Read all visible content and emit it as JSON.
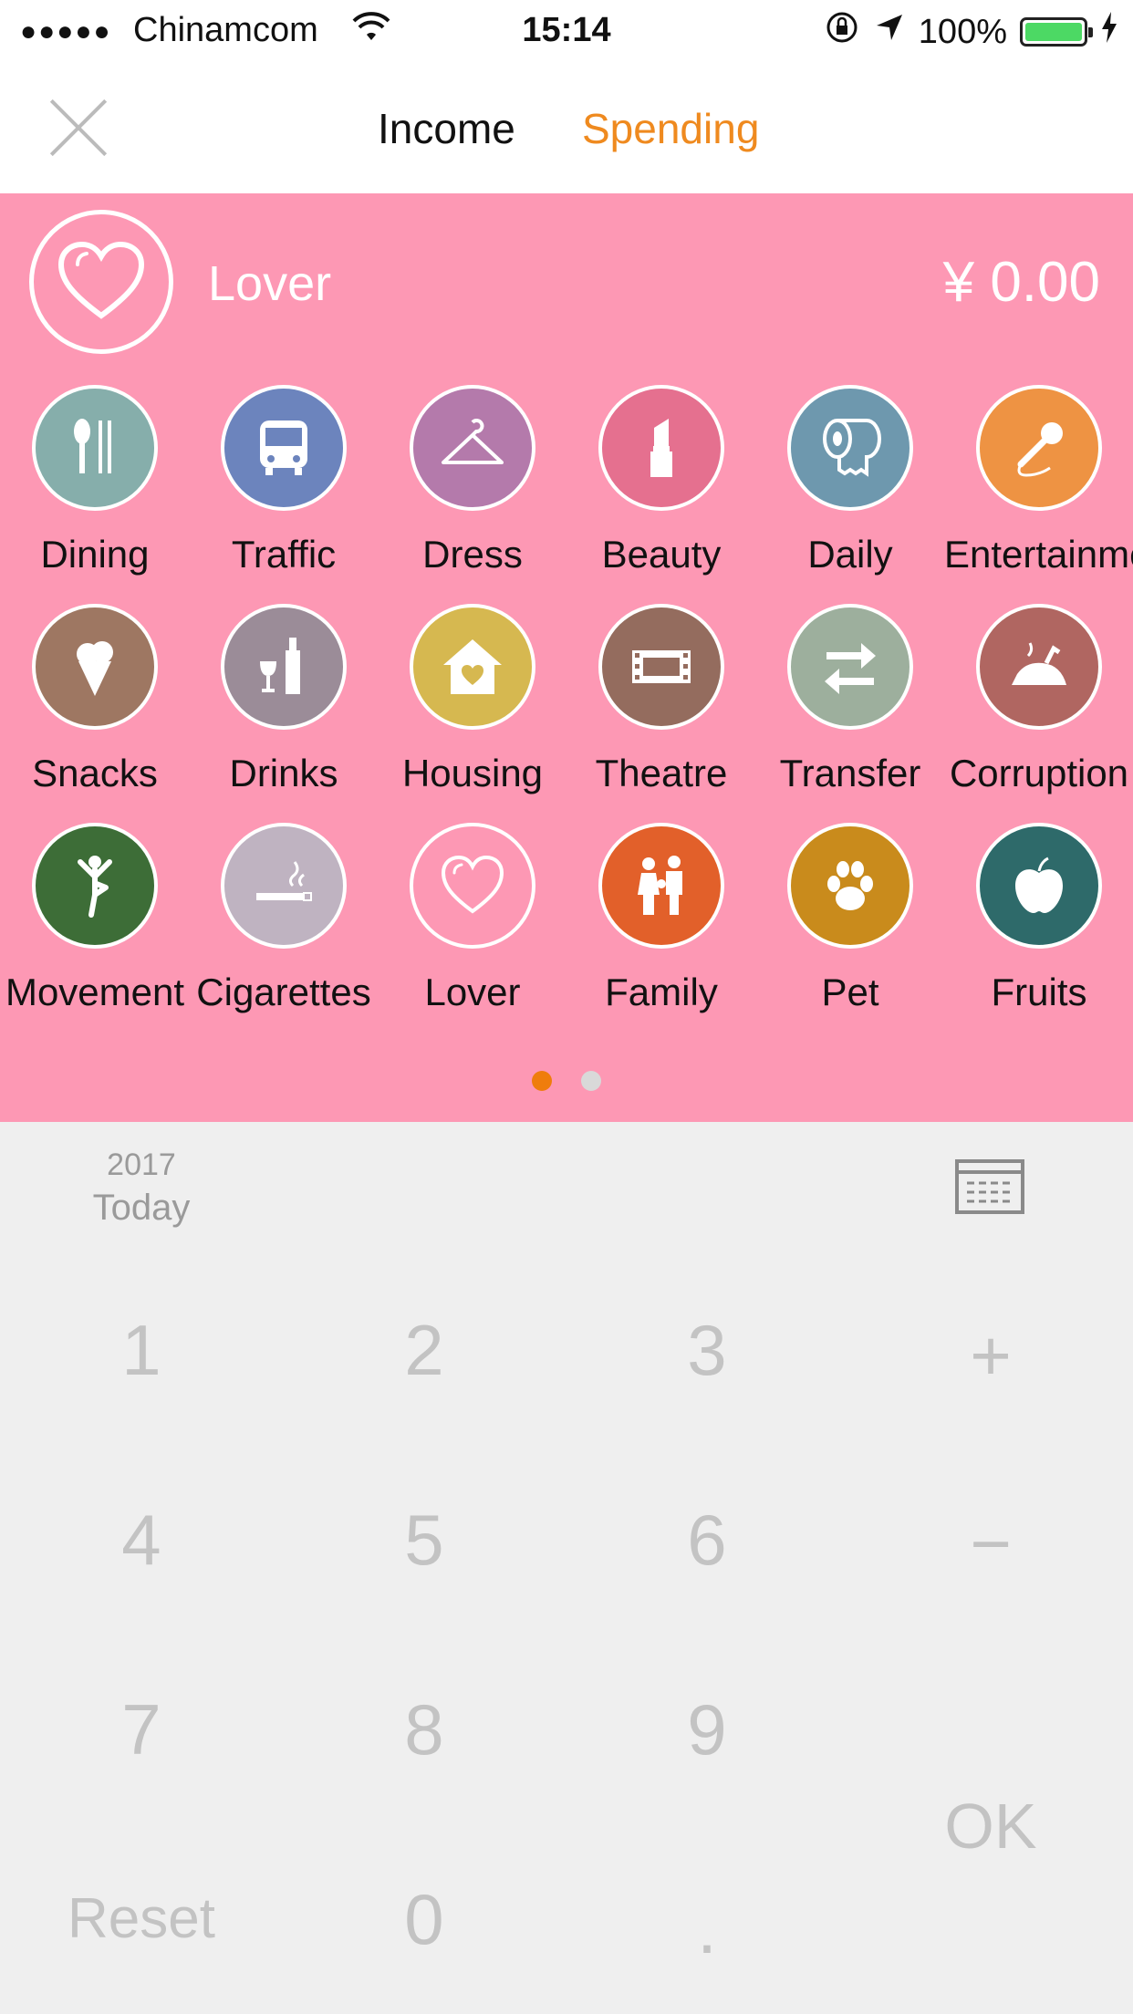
{
  "status_bar": {
    "signal": "●●●●●",
    "carrier": "Chinamcom",
    "time": "15:14",
    "battery": "100%",
    "battery_color": "#4cd964"
  },
  "nav": {
    "tab_income": "Income",
    "tab_spending": "Spending",
    "active_tab": "Spending",
    "active_color": "#ef8a1f"
  },
  "selected": {
    "name": "Lover",
    "icon": "heart-icon",
    "amount": "¥ 0.00"
  },
  "panel_color": "#fd98b4",
  "categories": [
    {
      "label": "Dining",
      "icon": "dining-icon",
      "color": "#86aeab"
    },
    {
      "label": "Traffic",
      "icon": "bus-icon",
      "color": "#6c84bd"
    },
    {
      "label": "Dress",
      "icon": "hanger-icon",
      "color": "#b47aab"
    },
    {
      "label": "Beauty",
      "icon": "lipstick-icon",
      "color": "#e5708f"
    },
    {
      "label": "Daily",
      "icon": "toilet-paper-icon",
      "color": "#6e98ae"
    },
    {
      "label": "Entertainme",
      "icon": "microphone-icon",
      "color": "#ee9343"
    },
    {
      "label": "Snacks",
      "icon": "ice-cream-icon",
      "color": "#9e7762"
    },
    {
      "label": "Drinks",
      "icon": "wine-icon",
      "color": "#9b8c98"
    },
    {
      "label": "Housing",
      "icon": "house-icon",
      "color": "#d6b850"
    },
    {
      "label": "Theatre",
      "icon": "film-icon",
      "color": "#946c5e"
    },
    {
      "label": "Transfer",
      "icon": "transfer-icon",
      "color": "#9daf9d"
    },
    {
      "label": "Corruption",
      "icon": "roast-chicken-icon",
      "color": "#b06661"
    },
    {
      "label": "Movement",
      "icon": "yoga-icon",
      "color": "#3d6d37"
    },
    {
      "label": "Cigarettes",
      "icon": "cigarette-icon",
      "color": "#bfb3c1"
    },
    {
      "label": "Lover",
      "icon": "heart-icon",
      "color": "#fd98b4"
    },
    {
      "label": "Family",
      "icon": "family-icon",
      "color": "#e2602a"
    },
    {
      "label": "Pet",
      "icon": "paw-icon",
      "color": "#c98b1c"
    },
    {
      "label": "Fruits",
      "icon": "apple-icon",
      "color": "#2e6a6a"
    }
  ],
  "pager": {
    "pages": 2,
    "current": 1,
    "active_color": "#ef7d0c",
    "inactive_color": "#d9d9d9"
  },
  "date": {
    "year": "2017",
    "day": "Today"
  },
  "keypad": {
    "k1": "1",
    "k2": "2",
    "k3": "3",
    "plus": "+",
    "k4": "4",
    "k5": "5",
    "k6": "6",
    "minus": "−",
    "k7": "7",
    "k8": "8",
    "k9": "9",
    "ok": "OK",
    "reset": "Reset",
    "k0": "0",
    "dot": "."
  }
}
